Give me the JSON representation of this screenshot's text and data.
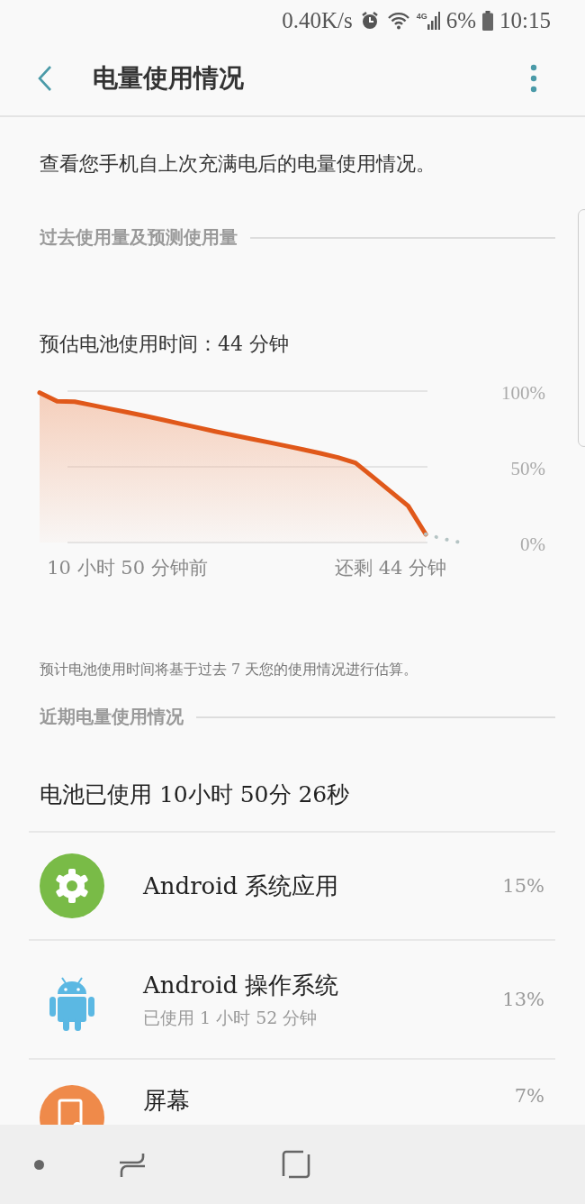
{
  "status_bar": {
    "net_speed": "0.40K/s",
    "network_type": "4G",
    "battery": "6%",
    "time": "10:15"
  },
  "app_bar": {
    "title": "电量使用情况"
  },
  "description": "查看您手机自上次充满电后的电量使用情况。",
  "history_section": {
    "header": "过去使用量及预测使用量",
    "estimate": "预估电池使用时间：44 分钟",
    "chart_data": {
      "type": "area",
      "categories": [
        null,
        null,
        null,
        null,
        null,
        "10 小时 50 分钟前",
        null,
        null,
        null,
        null,
        null,
        null,
        null,
        null,
        null,
        null,
        null,
        null,
        null,
        null,
        "还剩 44 分钟",
        null,
        null,
        null,
        null
      ],
      "series": [
        {
          "color": "#e0581a",
          "values": [
            99,
            93.3,
            93,
            90.7,
            88.3,
            86,
            83.6,
            81.1,
            78.5,
            76,
            73.4,
            71,
            68.6,
            66.3,
            63.9,
            61.5,
            58.9,
            56.2,
            52.6,
            43.2,
            33.7,
            24.2,
            5.5,
            null,
            null
          ]
        },
        {
          "type": "line",
          "line_style": "dotted",
          "color": "#b5c4c4",
          "values": [
            null,
            null,
            null,
            null,
            null,
            null,
            null,
            null,
            null,
            null,
            null,
            null,
            null,
            null,
            null,
            null,
            null,
            null,
            null,
            null,
            null,
            null,
            5.5,
            2.4,
            0
          ]
        }
      ],
      "ylim": [
        0,
        100
      ],
      "yticks": [
        {
          "value": 0,
          "label": "0%"
        },
        {
          "value": 50,
          "label": "50%"
        },
        {
          "value": 100,
          "label": "100%"
        }
      ]
    },
    "footnote": "预计电池使用时间将基于过去 7 天您的使用情况进行估算。"
  },
  "recent_section": {
    "header": "近期电量使用情况",
    "total": "电池已使用 10小时 50分 26秒",
    "apps": [
      {
        "kind": "gear",
        "name": "Android 系统应用",
        "percent": "15%"
      },
      {
        "kind": "android",
        "name": "Android 操作系统",
        "detail": "已使用 1 小时 52 分钟",
        "percent": "13%"
      },
      {
        "kind": "screen",
        "name": "屏幕",
        "percent": "7%"
      }
    ]
  }
}
